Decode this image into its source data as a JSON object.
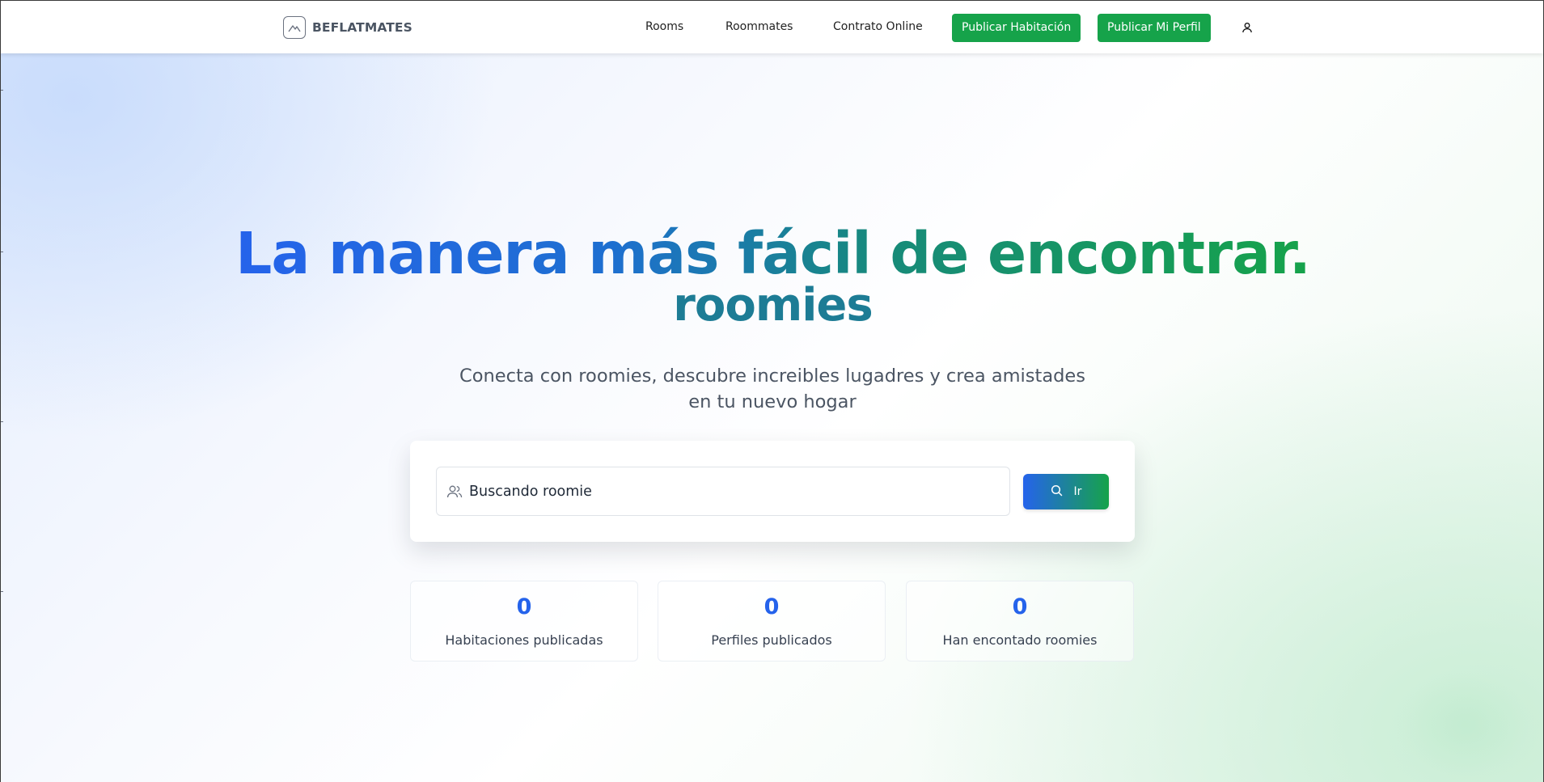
{
  "header": {
    "brand_name": "BEFLATMATES",
    "nav": {
      "rooms": "Rooms",
      "roommates": "Roommates",
      "contract": "Contrato Online"
    },
    "buttons": {
      "publish_room": "Publicar Habitación",
      "publish_profile": "Publicar Mi Perfil"
    },
    "user_icon": "user-icon"
  },
  "hero": {
    "title_line1": "La manera más fácil de encontrar.",
    "title_line2": "roomies",
    "subtitle": "Conecta con roomies, descubre increibles lugadres y crea amistades en tu nuevo hogar"
  },
  "search": {
    "value": "Buscando roomie",
    "field_icon": "users-icon",
    "button_label": "Ir",
    "button_icon": "search-icon"
  },
  "stats": [
    {
      "value": "0",
      "label": "Habitaciones publicadas"
    },
    {
      "value": "0",
      "label": "Perfiles publicados"
    },
    {
      "value": "0",
      "label": "Han encontado roomies"
    }
  ],
  "colors": {
    "primary_blue": "#2563eb",
    "accent_green": "#16a34a",
    "title_teal": "#1d7c95"
  }
}
